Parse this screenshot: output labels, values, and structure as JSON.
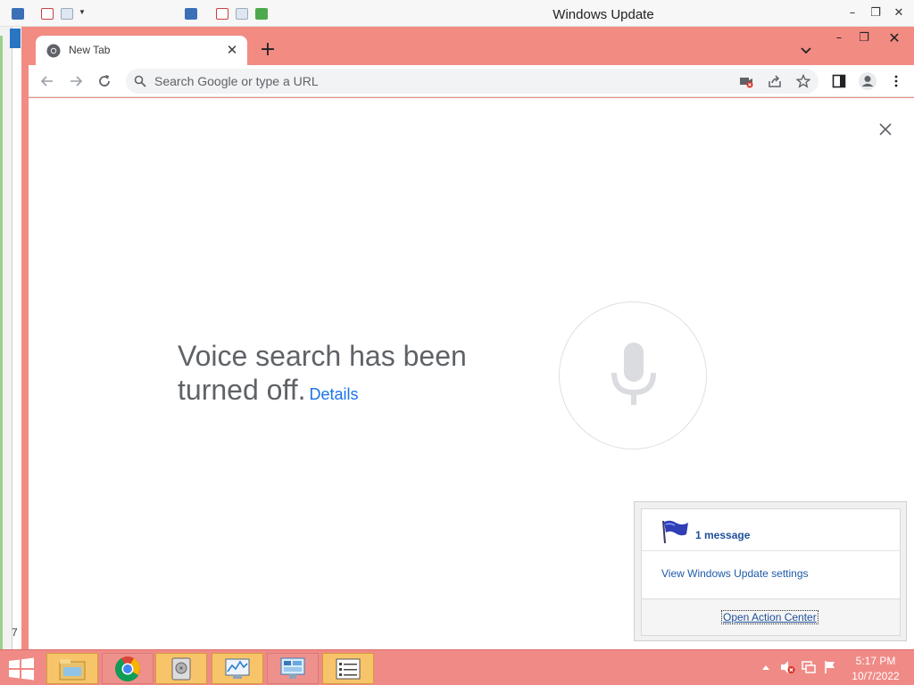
{
  "background_window": {
    "title": "Windows Update",
    "digit": "7",
    "controls": {
      "minimize": "–",
      "restore": "❐",
      "close": "✕"
    }
  },
  "browser": {
    "tab": {
      "title": "New Tab",
      "close": "✕",
      "favicon": "chrome-icon"
    },
    "new_tab": "+",
    "tab_search": "chevron-down-icon",
    "window_controls": {
      "minimize": "–",
      "restore": "❐",
      "close": "✕"
    },
    "toolbar": {
      "back": "back-arrow-icon",
      "forward": "forward-arrow-icon",
      "reload": "reload-icon",
      "placeholder": "Search Google or type a URL",
      "icons": [
        "camera-blocked-icon",
        "share-icon",
        "star-icon",
        "side-panel-icon",
        "profile-icon",
        "more-vert-icon"
      ]
    },
    "content": {
      "voice_message": "Voice search has been turned off.",
      "details_link": "Details",
      "dismiss": "close-icon",
      "mic": "microphone-icon"
    },
    "accent_color": "#f28b82"
  },
  "notification": {
    "count": "1 message",
    "link": "View Windows Update settings",
    "action": "Open Action Center",
    "flag": "flag-icon"
  },
  "taskbar": {
    "items": [
      {
        "name": "file-explorer-icon",
        "active": true
      },
      {
        "name": "chrome-icon",
        "active": false
      },
      {
        "name": "disk-icon",
        "active": true
      },
      {
        "name": "performance-monitor-icon",
        "active": true
      },
      {
        "name": "control-panel-icon",
        "active": false
      },
      {
        "name": "list-icon",
        "active": true
      }
    ],
    "time": "5:17 PM",
    "date": "10/7/2022",
    "tray_icons": [
      "show-hidden-icons-icon",
      "volume-muted-icon",
      "network-icon",
      "action-center-flag-icon"
    ]
  }
}
